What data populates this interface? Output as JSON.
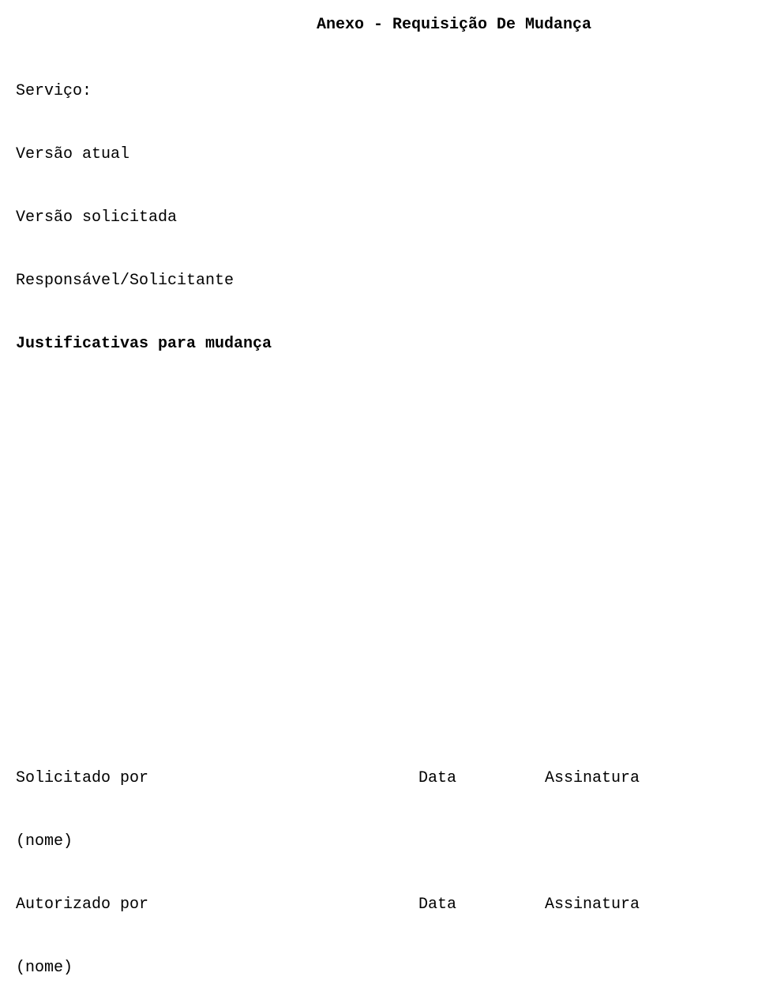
{
  "title": "Anexo - Requisição De Mudança",
  "fields": {
    "servico": "Serviço:",
    "versao_atual": "Versão atual",
    "versao_solicitada": "Versão solicitada",
    "responsavel_solicitante": "Responsável/Solicitante",
    "justificativas": "Justificativas para mudança"
  },
  "signature": {
    "solicitado_por": "Solicitado por",
    "autorizado_por": "Autorizado por",
    "data": "Data",
    "assinatura": "Assinatura",
    "nome": "(nome)"
  }
}
